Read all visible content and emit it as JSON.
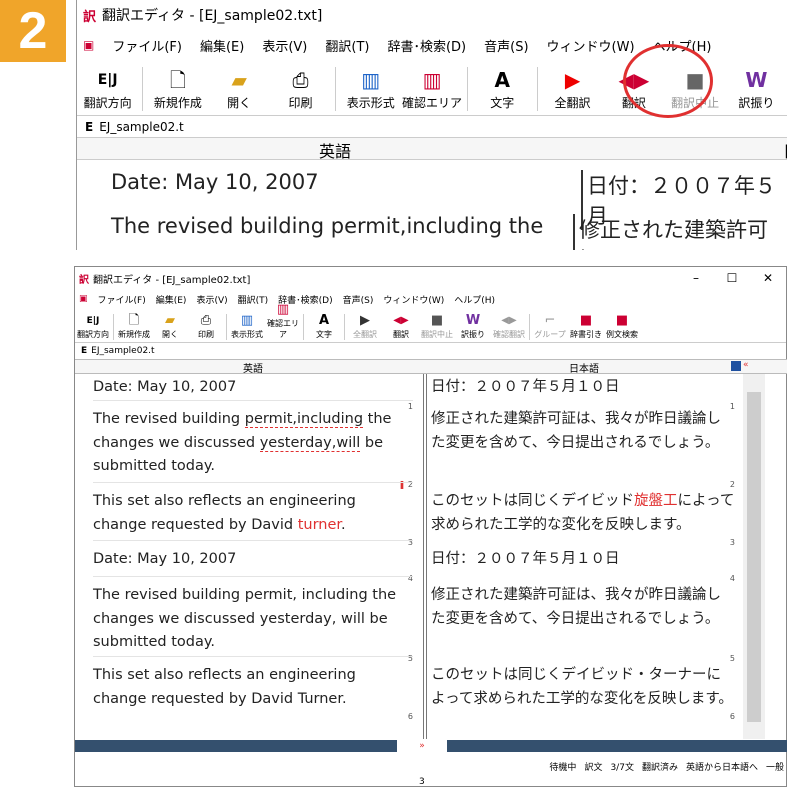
{
  "step": "2",
  "app": {
    "title": "翻訳エディタ - [EJ_sample02.txt]",
    "tab": "EJ_sample02.t",
    "tab_small": "EJ_sample02.t",
    "menu": [
      "ファイル(F)",
      "編集(E)",
      "表示(V)",
      "翻訳(T)",
      "辞書･検索(D)",
      "音声(S)",
      "ウィンドウ(W)",
      "ヘルプ(H)"
    ],
    "toolbar_zoom": [
      "翻訳方向",
      "新規作成",
      "開く",
      "印刷",
      "表示形式",
      "確認エリア",
      "文字",
      "全翻訳",
      "翻訳",
      "翻訳中止",
      "訳振り"
    ],
    "toolbar_main": [
      "翻訳方向",
      "新規作成",
      "開く",
      "印刷",
      "表示形式",
      "確認エリア",
      "文字",
      "全翻訳",
      "翻訳",
      "翻訳中止",
      "訳振り",
      "確認翻訳",
      "グループ",
      "辞書引き",
      "例文検索"
    ],
    "ej_label": "E|J",
    "col_en": "英語",
    "col_ja": "日本語",
    "col_ja_partial": "日"
  },
  "zoom_rows": {
    "en1": "Date: May 10, 2007",
    "en2": "The revised building permit,including the",
    "ja1": "日付：２００７年５月",
    "ja2": "修正された建築許可証"
  },
  "segments_en": [
    {
      "text": "Date: May 10, 2007",
      "num": "1"
    },
    {
      "text_a": "The revised building ",
      "text_b": "permit,including",
      "text_c": " the changes we discussed ",
      "text_d": "yesterday,will",
      "text_e": " be submitted today.",
      "num": "2"
    },
    {
      "text_a": "This set also reflects an engineering change requested by David ",
      "text_b": "turner",
      "text_c": ".",
      "num": "3"
    },
    {
      "text": "Date: May 10, 2007",
      "num": "4"
    },
    {
      "text": "The revised building permit, including the changes we discussed yesterday, will be submitted today.",
      "num": "5"
    },
    {
      "text": "This set also reflects an engineering change requested by David Turner.",
      "num": "6"
    }
  ],
  "segments_ja": [
    {
      "text": "日付：２００７年５月１０日",
      "num": "1"
    },
    {
      "text": "修正された建築許可証は、我々が昨日議論した変更を含めて、今日提出されるでしょう。",
      "num": "2"
    },
    {
      "text_a": "このセットは同じくデイビッド",
      "text_b": "旋盤工",
      "text_c": "によって求められた工学的な変化を反映します。",
      "num": "3"
    },
    {
      "text": "日付：２００７年５月１０日",
      "num": "4"
    },
    {
      "text": "修正された建築許可証は、我々が昨日議論した変更を含めて、今日提出されるでしょう。",
      "num": "5"
    },
    {
      "text": "このセットは同じくデイビッド・ターナーによって求められた工学的な変化を反映します。",
      "num": "6"
    }
  ],
  "status": [
    "待機中",
    "訳文",
    "3/7文",
    "翻訳済み",
    "英語から日本語へ",
    "一般"
  ],
  "bottom_num": "3",
  "error_mark": "2"
}
